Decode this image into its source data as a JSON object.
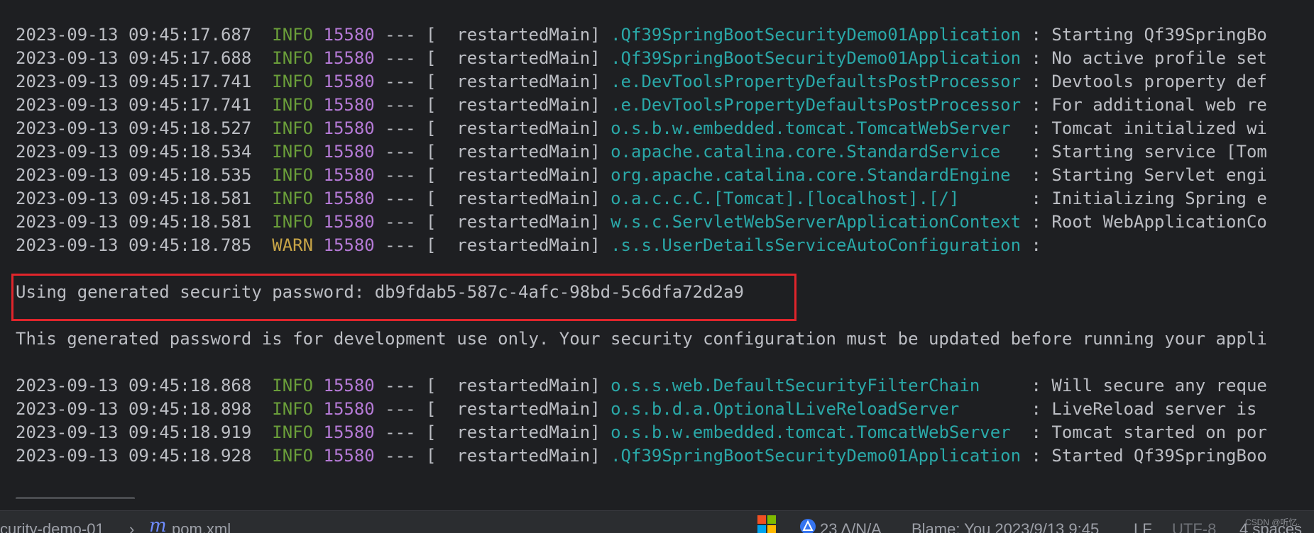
{
  "console": {
    "lines": [
      {
        "ts": "2023-09-13 09:45:17.687",
        "level": "INFO",
        "pid": "15580",
        "thread": "--- [  restartedMain]",
        "logger": ".Qf39SpringBootSecurityDemo01Application",
        "msg": ": Starting Qf39SpringBo"
      },
      {
        "ts": "2023-09-13 09:45:17.688",
        "level": "INFO",
        "pid": "15580",
        "thread": "--- [  restartedMain]",
        "logger": ".Qf39SpringBootSecurityDemo01Application",
        "msg": ": No active profile set"
      },
      {
        "ts": "2023-09-13 09:45:17.741",
        "level": "INFO",
        "pid": "15580",
        "thread": "--- [  restartedMain]",
        "logger": ".e.DevToolsPropertyDefaultsPostProcessor",
        "msg": ": Devtools property def"
      },
      {
        "ts": "2023-09-13 09:45:17.741",
        "level": "INFO",
        "pid": "15580",
        "thread": "--- [  restartedMain]",
        "logger": ".e.DevToolsPropertyDefaultsPostProcessor",
        "msg": ": For additional web re"
      },
      {
        "ts": "2023-09-13 09:45:18.527",
        "level": "INFO",
        "pid": "15580",
        "thread": "--- [  restartedMain]",
        "logger": "o.s.b.w.embedded.tomcat.TomcatWebServer ",
        "msg": ": Tomcat initialized wi"
      },
      {
        "ts": "2023-09-13 09:45:18.534",
        "level": "INFO",
        "pid": "15580",
        "thread": "--- [  restartedMain]",
        "logger": "o.apache.catalina.core.StandardService  ",
        "msg": ": Starting service [Tom"
      },
      {
        "ts": "2023-09-13 09:45:18.535",
        "level": "INFO",
        "pid": "15580",
        "thread": "--- [  restartedMain]",
        "logger": "org.apache.catalina.core.StandardEngine ",
        "msg": ": Starting Servlet engi"
      },
      {
        "ts": "2023-09-13 09:45:18.581",
        "level": "INFO",
        "pid": "15580",
        "thread": "--- [  restartedMain]",
        "logger": "o.a.c.c.C.[Tomcat].[localhost].[/]      ",
        "msg": ": Initializing Spring e"
      },
      {
        "ts": "2023-09-13 09:45:18.581",
        "level": "INFO",
        "pid": "15580",
        "thread": "--- [  restartedMain]",
        "logger": "w.s.c.ServletWebServerApplicationContext",
        "msg": ": Root WebApplicationCo"
      },
      {
        "ts": "2023-09-13 09:45:18.785",
        "level": "WARN",
        "pid": "15580",
        "thread": "--- [  restartedMain]",
        "logger": ".s.s.UserDetailsServiceAutoConfiguration",
        "msg": ":"
      }
    ],
    "password_line": "Using generated security password: db9fdab5-587c-4afc-98bd-5c6dfa72d2a9",
    "notice_line": "This generated password is for development use only. Your security configuration must be updated before running your appli",
    "lines2": [
      {
        "ts": "2023-09-13 09:45:18.868",
        "level": "INFO",
        "pid": "15580",
        "thread": "--- [  restartedMain]",
        "logger": "o.s.s.web.DefaultSecurityFilterChain    ",
        "msg": ": Will secure any reque"
      },
      {
        "ts": "2023-09-13 09:45:18.898",
        "level": "INFO",
        "pid": "15580",
        "thread": "--- [  restartedMain]",
        "logger": "o.s.b.d.a.OptionalLiveReloadServer      ",
        "msg": ": LiveReload server is"
      },
      {
        "ts": "2023-09-13 09:45:18.919",
        "level": "INFO",
        "pid": "15580",
        "thread": "--- [  restartedMain]",
        "logger": "o.s.b.w.embedded.tomcat.TomcatWebServer ",
        "msg": ": Tomcat started on por"
      },
      {
        "ts": "2023-09-13 09:45:18.928",
        "level": "INFO",
        "pid": "15580",
        "thread": "--- [  restartedMain]",
        "logger": ".Qf39SpringBootSecurityDemo01Application",
        "msg": ": Started Qf39SpringBoo"
      }
    ]
  },
  "statusbar": {
    "breadcrumb_project": "curity-demo-01",
    "breadcrumb_sep": "›",
    "file_icon_glyph": "m",
    "file_name": "pom.xml",
    "warnings": "23 Δ/N/A",
    "blame": "Blame: You 2023/9/13 9:45",
    "line_sep": "LF",
    "encoding": "UTF-8",
    "indent": "4 spaces",
    "watermark": "CSDN @听忆."
  },
  "colors": {
    "info": "#6a9e3a",
    "warn": "#c7a447",
    "pid": "#b57ad6",
    "logger": "#2aa8a8",
    "highlight_box": "#e0252b"
  }
}
